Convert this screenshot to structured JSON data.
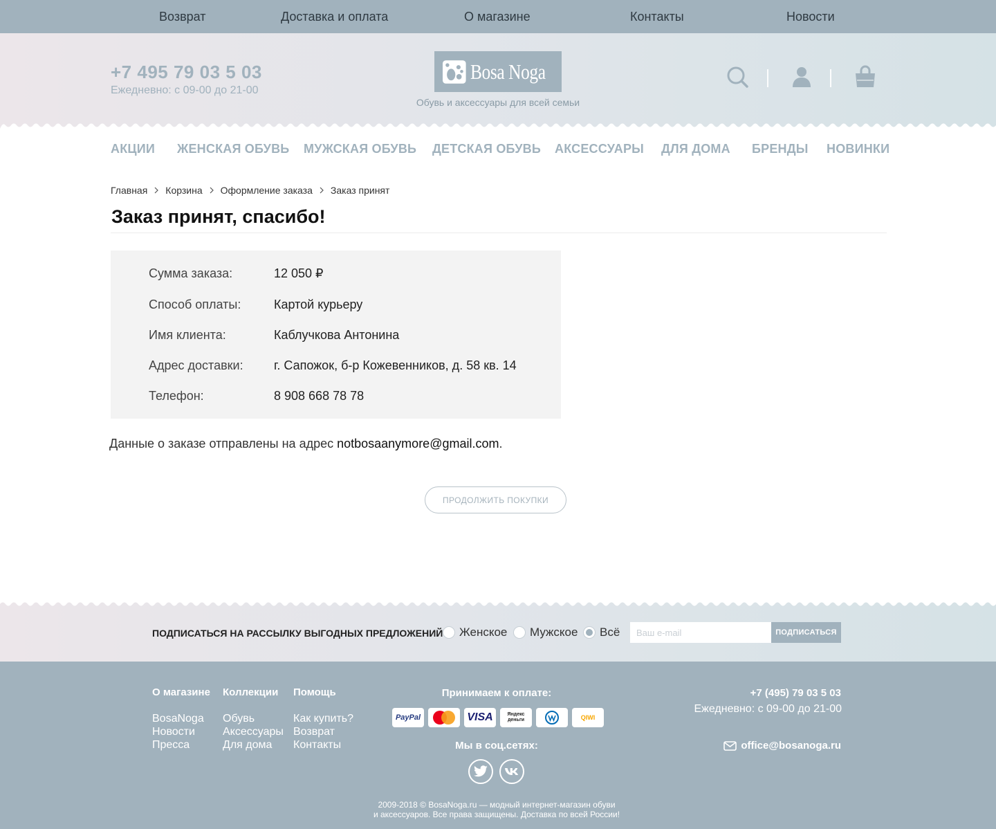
{
  "topnav": [
    "Возврат",
    "Доставка и оплата",
    "О магазине",
    "Контакты",
    "Новости"
  ],
  "header": {
    "phone": "+7 495 79 03 5 03",
    "hours": "Ежедневно: с 09-00 до 21-00",
    "logo_text": "Bosa Noga",
    "tagline": "Обувь и аксессуары для всей семьи",
    "icons": [
      "search-icon",
      "user-icon",
      "cart-icon"
    ]
  },
  "categories": [
    "АКЦИИ",
    "ЖЕНСКАЯ ОБУВЬ",
    "МУЖСКАЯ ОБУВЬ",
    "ДЕТСКАЯ ОБУВЬ",
    "АКСЕССУАРЫ",
    "ДЛЯ ДОМА",
    "БРЕНДЫ",
    "НОВИНКИ"
  ],
  "breadcrumb": [
    "Главная",
    "Корзина",
    "Оформление заказа",
    "Заказ принят"
  ],
  "page_title": "Заказ принят, спасибо!",
  "order": {
    "rows": [
      {
        "label": "Сумма заказа:",
        "value": "12 050 ₽"
      },
      {
        "label": "Способ оплаты:",
        "value": "Картой курьеру"
      },
      {
        "label": "Имя клиента:",
        "value": "Каблучкова Антонина"
      },
      {
        "label": "Адрес доставки:",
        "value": "г. Сапожок, б-р Кожевенников, д. 58 кв. 14"
      },
      {
        "label": "Телефон:",
        "value": "8 908 668 78 78"
      }
    ]
  },
  "sent_note": {
    "text": "Данные о заказе отправлены на адрес ",
    "email": "notbosaanymore@gmail.com",
    "end": "."
  },
  "continue_button": "ПРОДОЛЖИТЬ ПОКУПКИ",
  "subscribe": {
    "title": "ПОДПИСАТЬСЯ НА РАССЫЛКУ ВЫГОДНЫХ ПРЕДЛОЖЕНИЙ",
    "options": [
      {
        "label": "Женское",
        "selected": false
      },
      {
        "label": "Мужское",
        "selected": false
      },
      {
        "label": "Всё",
        "selected": true
      }
    ],
    "email_placeholder": "Ваш e-mail",
    "button": "ПОДПИСАТЬСЯ"
  },
  "footer": {
    "columns": [
      {
        "title": "О магазине",
        "links": [
          "BosaNoga",
          "Новости",
          "Пресса"
        ]
      },
      {
        "title": "Коллекции",
        "links": [
          "Обувь",
          "Аксессуары",
          "Для дома"
        ]
      },
      {
        "title": "Помощь",
        "links": [
          "Как купить?",
          "Возврат",
          "Контакты"
        ]
      }
    ],
    "payment_title": "Принимаем к оплате:",
    "payment_methods": [
      {
        "name": "PayPal",
        "color": "#253b80"
      },
      {
        "name": "MasterCard",
        "color": "#eb001b"
      },
      {
        "name": "VISA",
        "color": "#1a1f71"
      },
      {
        "name": "Яндекс деньги",
        "color": "#222222"
      },
      {
        "name": "WebMoney",
        "color": "#036cb5"
      },
      {
        "name": "QIWI",
        "color": "#f7a600"
      }
    ],
    "social_title": "Мы в соц.сетях:",
    "social": [
      "twitter-icon",
      "vk-icon"
    ],
    "phone": "+7 (495) 79 03 5 03",
    "hours": "Ежедневно: с 09-00 до 21-00",
    "email": "office@bosanoga.ru",
    "copyright_line1": "2009-2018 © BosaNoga.ru — модный интернет-магазин обуви",
    "copyright_line2": "и аксессуаров. Все права защищены. Доставка по всей России!"
  },
  "colors": {
    "accent": "#a1b2bd",
    "box_bg": "#f3f3f3"
  }
}
